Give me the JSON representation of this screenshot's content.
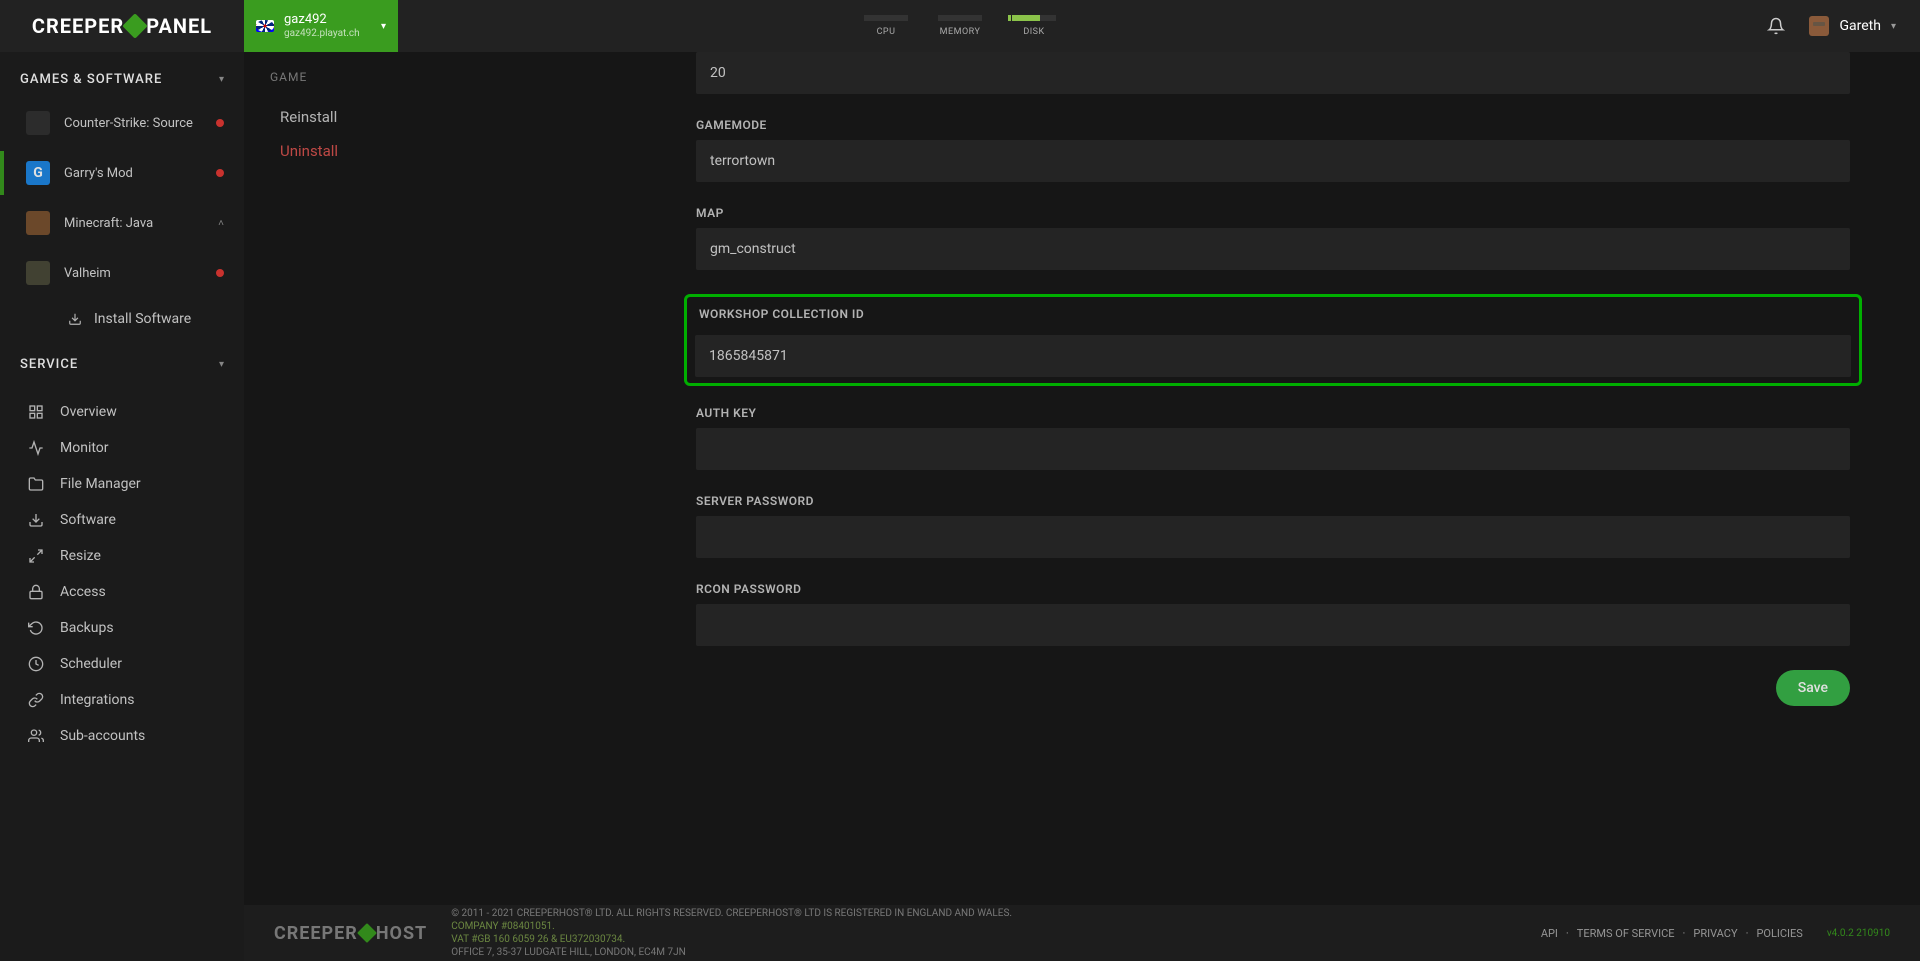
{
  "logo": {
    "part1": "CREEPER",
    "part2": "PANEL"
  },
  "server": {
    "name": "gaz492",
    "sub": "gaz492.playat.ch"
  },
  "meters": [
    {
      "label": "CPU"
    },
    {
      "label": "MEMORY"
    },
    {
      "label": "DISK"
    }
  ],
  "user": {
    "name": "Gareth"
  },
  "sidebar": {
    "games_header": "GAMES & SOFTWARE",
    "games": [
      {
        "name": "Counter-Strike: Source",
        "status": "red"
      },
      {
        "name": "Garry's Mod",
        "status": "red",
        "active": true
      },
      {
        "name": "Minecraft: Java",
        "expandable": true
      },
      {
        "name": "Valheim",
        "status": "red"
      }
    ],
    "install_label": "Install Software",
    "service_header": "SERVICE",
    "service": [
      {
        "label": "Overview",
        "icon": "grid"
      },
      {
        "label": "Monitor",
        "icon": "activity"
      },
      {
        "label": "File Manager",
        "icon": "folder"
      },
      {
        "label": "Software",
        "icon": "download"
      },
      {
        "label": "Resize",
        "icon": "expand"
      },
      {
        "label": "Access",
        "icon": "lock"
      },
      {
        "label": "Backups",
        "icon": "refresh"
      },
      {
        "label": "Scheduler",
        "icon": "clock"
      },
      {
        "label": "Integrations",
        "icon": "link"
      },
      {
        "label": "Sub-accounts",
        "icon": "users"
      }
    ]
  },
  "subnav": {
    "header": "GAME",
    "items": [
      {
        "label": "Reinstall"
      },
      {
        "label": "Uninstall",
        "danger": true
      }
    ]
  },
  "form": {
    "field0": {
      "value": "20"
    },
    "gamemode": {
      "label": "GAMEMODE",
      "value": "terrortown"
    },
    "map": {
      "label": "MAP",
      "value": "gm_construct"
    },
    "workshop": {
      "label": "WORKSHOP COLLECTION ID",
      "value": "1865845871"
    },
    "auth": {
      "label": "AUTH KEY",
      "value": ""
    },
    "server_password": {
      "label": "SERVER PASSWORD",
      "value": ""
    },
    "rcon_password": {
      "label": "RCON PASSWORD",
      "value": ""
    },
    "save": "Save"
  },
  "footer": {
    "logo_p1": "CREEPER",
    "logo_p2": "HOST",
    "line1": "© 2011 - 2021 CREEPERHOST® LTD. ALL RIGHTS RESERVED. CREEPERHOST® LTD IS REGISTERED IN ENGLAND AND WALES.",
    "line2": "COMPANY #08401051.",
    "line3": "VAT #GB 160 6059 26 & EU372030734.",
    "line4": "OFFICE 7, 35-37 LUDGATE HILL, LONDON, EC4M 7JN",
    "links": [
      "API",
      "TERMS OF SERVICE",
      "PRIVACY",
      "POLICIES"
    ],
    "version": "v4.0.2 210910"
  }
}
